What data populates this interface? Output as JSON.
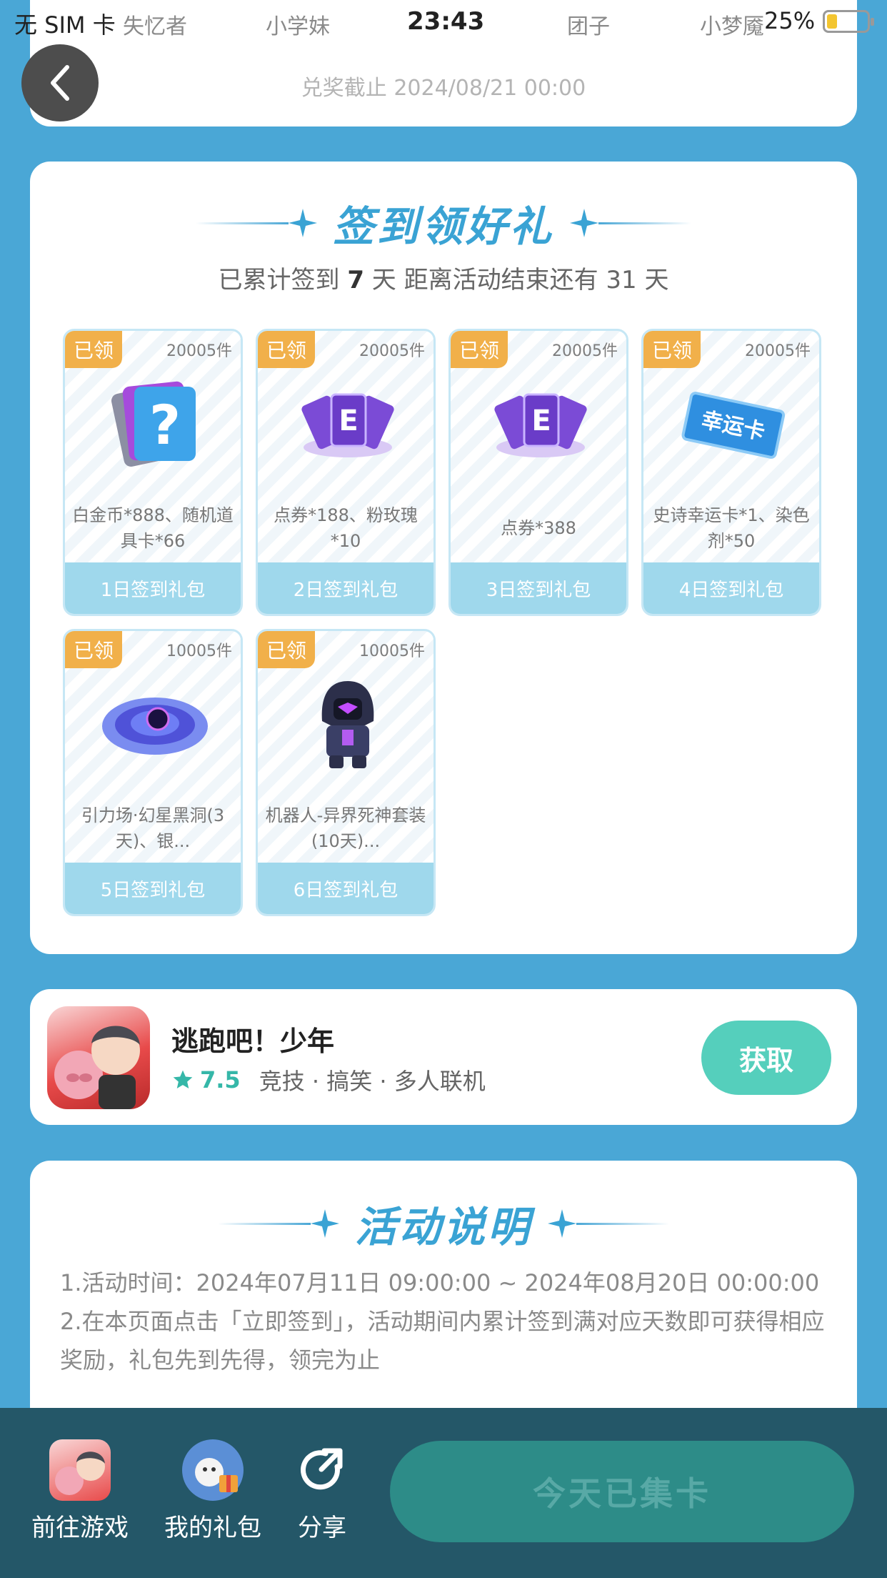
{
  "status_bar": {
    "carrier": "无 SIM 卡",
    "time": "23:43",
    "battery_pct": "25%",
    "background_names": [
      "失忆者",
      "小学妹",
      "团子",
      "小梦魇"
    ]
  },
  "deadline": "兑奖截止 2024/08/21 00:00",
  "sign_section": {
    "title": "签到领好礼",
    "days_prefix": "已累计签到 ",
    "days_count": "7",
    "days_suffix": " 天  距离活动结束还有 31 天"
  },
  "gifts": [
    {
      "badge": "已领",
      "count": "20005件",
      "desc": "白金币*888、随机道具卡*66",
      "label": "1日签到礼包"
    },
    {
      "badge": "已领",
      "count": "20005件",
      "desc": "点券*188、粉玫瑰*10",
      "label": "2日签到礼包"
    },
    {
      "badge": "已领",
      "count": "20005件",
      "desc": "点券*388",
      "label": "3日签到礼包"
    },
    {
      "badge": "已领",
      "count": "20005件",
      "desc": "史诗幸运卡*1、染色剂*50",
      "label": "4日签到礼包"
    },
    {
      "badge": "已领",
      "count": "10005件",
      "desc": "引力场·幻星黑洞(3天)、银...",
      "label": "5日签到礼包"
    },
    {
      "badge": "已领",
      "count": "10005件",
      "desc": "机器人-异界死神套装(10天)...",
      "label": "6日签到礼包"
    }
  ],
  "lucky_card_text": "幸运卡",
  "game": {
    "name": "逃跑吧！少年",
    "score": "7.5",
    "tags": "竞技 · 搞笑 · 多人联机",
    "button": "获取"
  },
  "rules": {
    "title": "活动说明",
    "line1": "1.活动时间：2024年07月11日 09:00:00 ~ 2024年08月20日 00:00:00",
    "line2": "2.在本页面点击「立即签到」，活动期间内累计签到满对应天数即可获得相应奖励，礼包先到先得，领完为止"
  },
  "bottom_nav": {
    "go_game": "前往游戏",
    "my_gifts": "我的礼包",
    "share": "分享",
    "done_button": "今天已集卡"
  },
  "colors": {
    "page_bg": "#4aa7d6",
    "accent_blue": "#3aa3d4",
    "badge_orange": "#f1b04a",
    "gift_footer": "#9fd8ec",
    "get_button": "#55cfbc",
    "bottom_bar": "#245768"
  }
}
